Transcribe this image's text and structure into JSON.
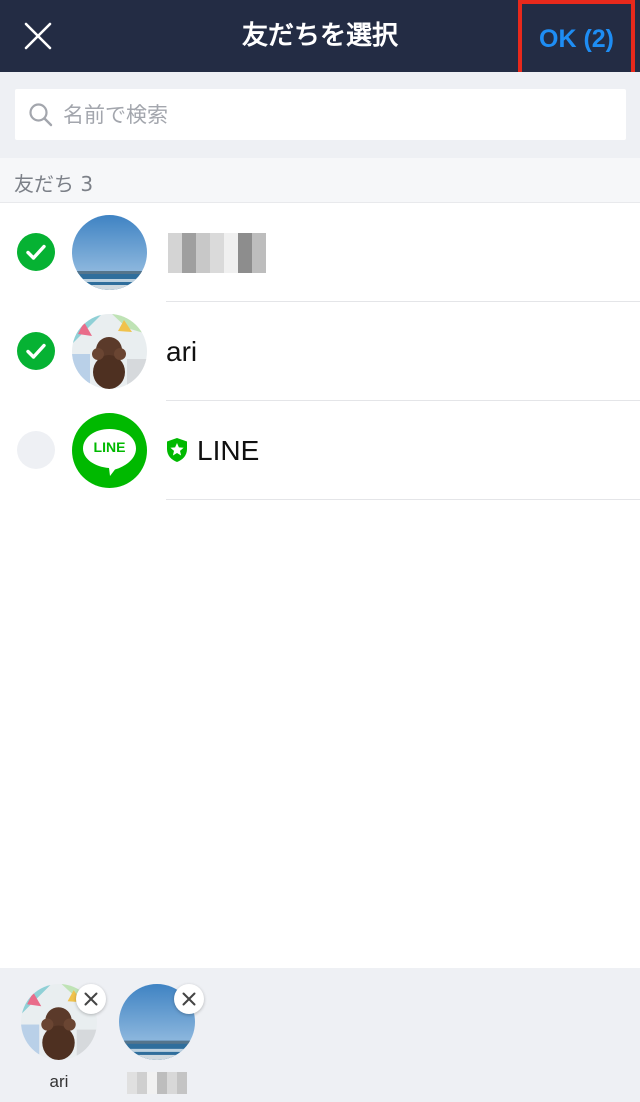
{
  "header": {
    "title": "友だちを選択",
    "ok_label": "OK (2)",
    "close_icon": "close-icon",
    "background": "#232c44",
    "ok_color": "#1e8df4",
    "highlight_color": "#e8291c"
  },
  "search": {
    "placeholder": "名前で検索",
    "value": ""
  },
  "section": {
    "label": "友だち 3"
  },
  "friends": [
    {
      "name": "",
      "selected": true,
      "avatar": "sea-horizon-photo",
      "name_obscured": true
    },
    {
      "name": "ari",
      "selected": true,
      "avatar": "poodle-photo"
    },
    {
      "name": "LINE",
      "selected": false,
      "avatar": "line-logo",
      "official": true,
      "logo_text": "LINE"
    }
  ],
  "selected_tray": [
    {
      "name": "ari",
      "avatar": "poodle-photo"
    },
    {
      "name": "",
      "avatar": "sea-horizon-photo",
      "name_obscured": true
    }
  ],
  "colors": {
    "check_green": "#06b233",
    "line_green": "#00b900"
  }
}
